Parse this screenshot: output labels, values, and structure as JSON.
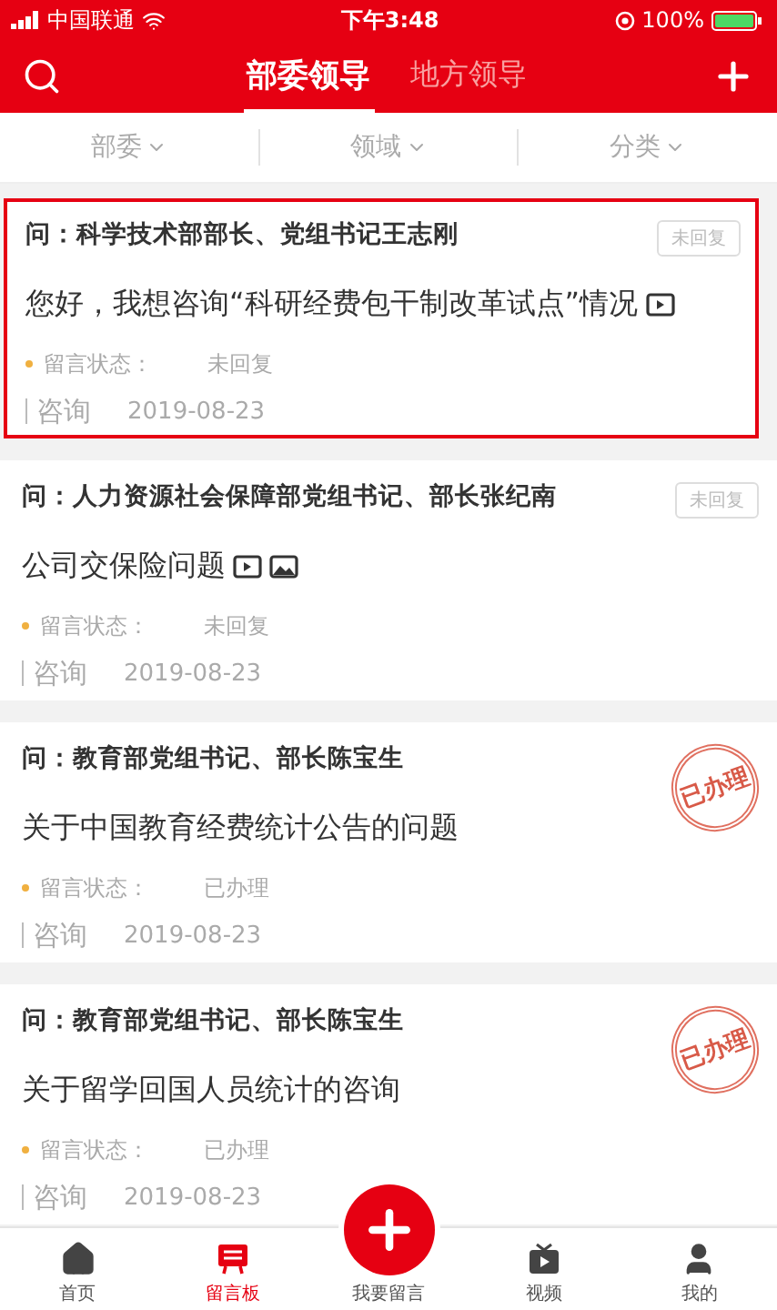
{
  "status_bar": {
    "carrier": "中国联通",
    "time": "下午3:48",
    "battery": "100%"
  },
  "header": {
    "tabs": [
      {
        "label": "部委领导",
        "selected": true
      },
      {
        "label": "地方领导",
        "selected": false
      }
    ]
  },
  "filters": [
    "部委",
    "领域",
    "分类"
  ],
  "cards": [
    {
      "question": "问：科学技术部部长、党组书记王志刚",
      "title": "您好，我想咨询“科研经费包干制改革试点”情况",
      "video_icon": true,
      "image_icon": false,
      "status_label": "留言状态：",
      "status": "未回复",
      "type": "咨询",
      "date": "2019-08-23",
      "mark": {
        "kind": "badge",
        "text": "未回复"
      },
      "highlighted": true
    },
    {
      "question": "问：人力资源社会保障部党组书记、部长张纪南",
      "title": "公司交保险问题",
      "video_icon": true,
      "image_icon": true,
      "status_label": "留言状态：",
      "status": "未回复",
      "type": "咨询",
      "date": "2019-08-23",
      "mark": {
        "kind": "badge",
        "text": "未回复"
      },
      "highlighted": false
    },
    {
      "question": "问：教育部党组书记、部长陈宝生",
      "title": "关于中国教育经费统计公告的问题",
      "video_icon": false,
      "image_icon": false,
      "status_label": "留言状态：",
      "status": "已办理",
      "type": "咨询",
      "date": "2019-08-23",
      "mark": {
        "kind": "stamp",
        "text": "已办理"
      },
      "highlighted": false
    },
    {
      "question": "问：教育部党组书记、部长陈宝生",
      "title": "关于留学回国人员统计的咨询",
      "video_icon": false,
      "image_icon": false,
      "status_label": "留言状态：",
      "status": "已办理",
      "type": "咨询",
      "date": "2019-08-23",
      "mark": {
        "kind": "stamp",
        "text": "已办理"
      },
      "highlighted": false
    }
  ],
  "nav": [
    {
      "label": "首页",
      "kind": "home",
      "selected": false
    },
    {
      "label": "留言板",
      "kind": "board",
      "selected": true
    },
    {
      "label": "我要留言",
      "kind": "fab",
      "selected": false
    },
    {
      "label": "视频",
      "kind": "video",
      "selected": false
    },
    {
      "label": "我的",
      "kind": "user",
      "selected": false
    }
  ]
}
